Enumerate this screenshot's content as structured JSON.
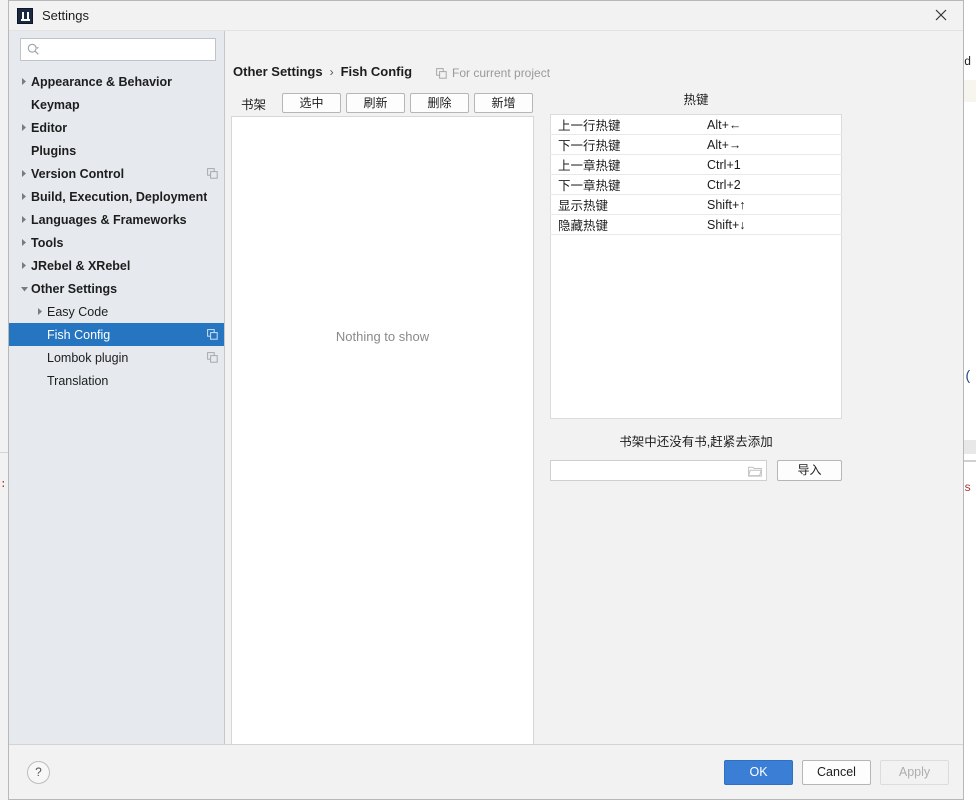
{
  "window": {
    "title": "Settings",
    "app_icon": "intellij-idea-icon",
    "close_label": "×"
  },
  "background": {
    "left_fragment": ":(",
    "right_fragments": [
      "d",
      "(",
      "s"
    ]
  },
  "sidebar": {
    "search": {
      "value": "",
      "placeholder": "",
      "icon": "search-icon"
    },
    "items": [
      {
        "label": "Appearance & Behavior",
        "level": 0,
        "arrow": "collapsed",
        "bold": true,
        "selected": false,
        "badge": false
      },
      {
        "label": "Keymap",
        "level": 0,
        "arrow": "none",
        "bold": true,
        "selected": false,
        "badge": false
      },
      {
        "label": "Editor",
        "level": 0,
        "arrow": "collapsed",
        "bold": true,
        "selected": false,
        "badge": false
      },
      {
        "label": "Plugins",
        "level": 0,
        "arrow": "none",
        "bold": true,
        "selected": false,
        "badge": false
      },
      {
        "label": "Version Control",
        "level": 0,
        "arrow": "collapsed",
        "bold": true,
        "selected": false,
        "badge": true
      },
      {
        "label": "Build, Execution, Deployment",
        "level": 0,
        "arrow": "collapsed",
        "bold": true,
        "selected": false,
        "badge": false
      },
      {
        "label": "Languages & Frameworks",
        "level": 0,
        "arrow": "collapsed",
        "bold": true,
        "selected": false,
        "badge": false
      },
      {
        "label": "Tools",
        "level": 0,
        "arrow": "collapsed",
        "bold": true,
        "selected": false,
        "badge": false
      },
      {
        "label": "JRebel & XRebel",
        "level": 0,
        "arrow": "collapsed",
        "bold": true,
        "selected": false,
        "badge": false
      },
      {
        "label": "Other Settings",
        "level": 0,
        "arrow": "expanded",
        "bold": true,
        "selected": false,
        "badge": false
      },
      {
        "label": "Easy Code",
        "level": 1,
        "arrow": "collapsed",
        "bold": false,
        "selected": false,
        "badge": false
      },
      {
        "label": "Fish Config",
        "level": 1,
        "arrow": "none",
        "bold": false,
        "selected": true,
        "badge": true
      },
      {
        "label": "Lombok plugin",
        "level": 1,
        "arrow": "none",
        "bold": false,
        "selected": false,
        "badge": true
      },
      {
        "label": "Translation",
        "level": 1,
        "arrow": "none",
        "bold": false,
        "selected": false,
        "badge": false
      }
    ]
  },
  "content": {
    "breadcrumb": {
      "parent": "Other Settings",
      "separator": "›",
      "current": "Fish Config"
    },
    "project_note": {
      "icon": "copy-icon",
      "text": "For current project"
    },
    "toolbar": {
      "label": "书架",
      "buttons": [
        {
          "label": "选中",
          "name": "select-button"
        },
        {
          "label": "刷新",
          "name": "refresh-button"
        },
        {
          "label": "删除",
          "name": "delete-button"
        },
        {
          "label": "新增",
          "name": "add-button"
        }
      ]
    },
    "list_panel": {
      "empty_text": "Nothing to show"
    },
    "hotkeys": {
      "title": "热键",
      "rows": [
        {
          "name": "上一行热键",
          "key": "Alt+←"
        },
        {
          "name": "下一行热键",
          "key": "Alt+→"
        },
        {
          "name": "上一章热键",
          "key": "Ctrl+1"
        },
        {
          "name": "下一章热键",
          "key": "Ctrl+2"
        },
        {
          "name": "显示热键",
          "key": "Shift+↑"
        },
        {
          "name": "隐藏热键",
          "key": "Shift+↓"
        }
      ]
    },
    "empty_message": "书架中还没有书,赶紧去添加",
    "import": {
      "path_value": "",
      "path_placeholder": "",
      "browse_icon": "folder-icon",
      "button_label": "导入"
    }
  },
  "footer": {
    "help_label": "?",
    "ok_label": "OK",
    "cancel_label": "Cancel",
    "apply_label": "Apply"
  },
  "colors": {
    "selection_blue": "#2675c0",
    "primary_button": "#3a7fd5",
    "sidebar_bg": "#e6eaee",
    "dialog_bg": "#f2f2f2"
  }
}
